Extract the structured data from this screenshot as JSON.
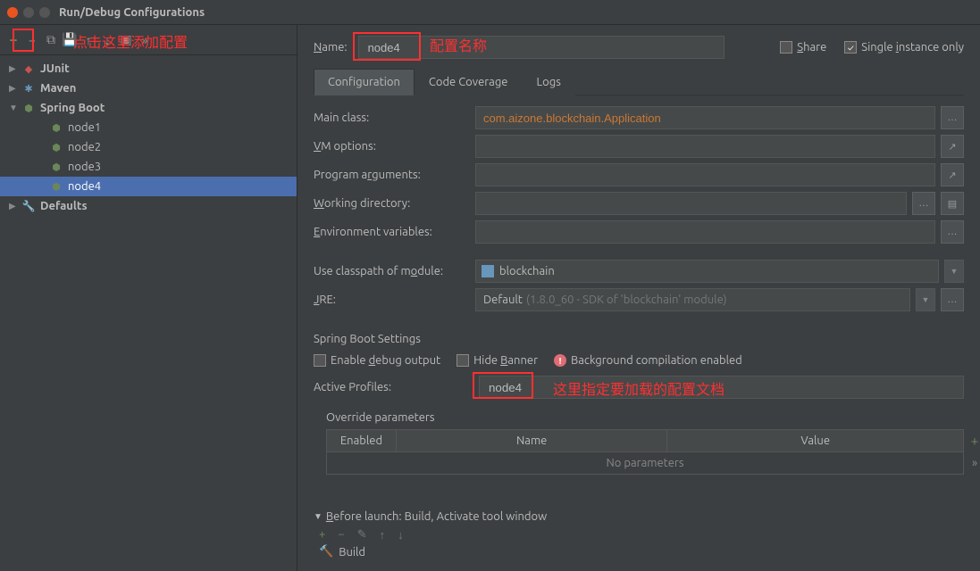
{
  "window": {
    "title": "Run/Debug Configurations"
  },
  "sidebar": {
    "items": [
      {
        "label": "JUnit",
        "type": "group"
      },
      {
        "label": "Maven",
        "type": "group"
      },
      {
        "label": "Spring Boot",
        "type": "group",
        "expanded": true
      },
      {
        "label": "node1",
        "type": "child"
      },
      {
        "label": "node2",
        "type": "child"
      },
      {
        "label": "node3",
        "type": "child"
      },
      {
        "label": "node4",
        "type": "child",
        "selected": true
      },
      {
        "label": "Defaults",
        "type": "group"
      }
    ]
  },
  "form": {
    "name_label": "Name:",
    "name_value": "node4",
    "share_label": "Share",
    "single_instance_label": "Single instance only",
    "tabs": {
      "configuration": "Configuration",
      "coverage": "Code Coverage",
      "logs": "Logs"
    },
    "labels": {
      "main_class": "Main class:",
      "vm_options": "VM options:",
      "program_args": "Program arguments:",
      "working_dir": "Working directory:",
      "env_vars": "Environment variables:",
      "classpath": "Use classpath of module:",
      "jre": "JRE:",
      "spring_settings": "Spring Boot Settings",
      "enable_debug": "Enable debug output",
      "hide_banner": "Hide Banner",
      "bg_compile": "Background compilation enabled",
      "active_profiles": "Active Profiles:",
      "override": "Override parameters",
      "before_launch": "Before launch: Build, Activate tool window",
      "build_item": "Build"
    },
    "values": {
      "main_class": "com.aizone.blockchain.Application",
      "module": "blockchain",
      "jre_default": "Default",
      "jre_hint": "(1.8.0_60 - SDK of 'blockchain' module)",
      "active_profiles": "node4"
    },
    "table": {
      "col_enabled": "Enabled",
      "col_name": "Name",
      "col_value": "Value",
      "empty": "No parameters"
    }
  },
  "annotations": {
    "add_config": "点击这里添加配置",
    "config_name": "配置名称",
    "load_profile": "这里指定要加载的配置文档"
  }
}
